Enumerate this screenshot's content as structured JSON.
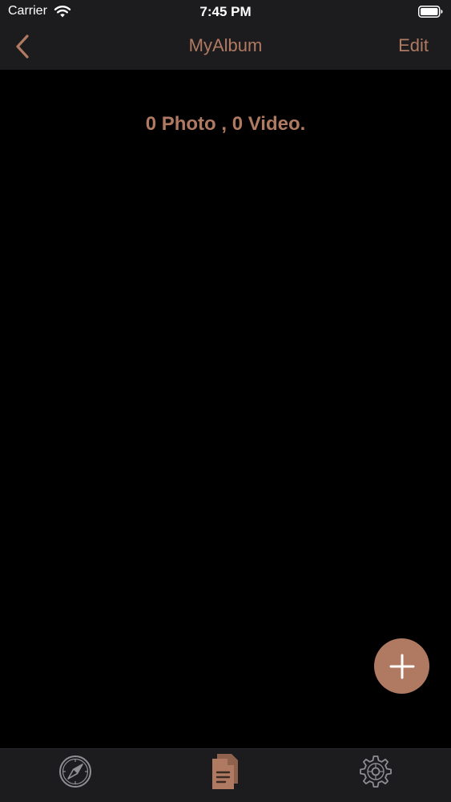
{
  "status_bar": {
    "carrier": "Carrier",
    "time": "7:45 PM",
    "wifi_icon": "wifi-icon",
    "battery_icon": "battery-icon"
  },
  "nav": {
    "title": "MyAlbum",
    "back_icon": "chevron-left-icon",
    "edit_label": "Edit"
  },
  "summary": "0 Photo , 0 Video.",
  "fab": {
    "icon": "plus-icon"
  },
  "tab_bar": {
    "tabs": [
      {
        "icon": "compass-icon",
        "selected": false
      },
      {
        "icon": "document-icon",
        "selected": true
      },
      {
        "icon": "gear-icon",
        "selected": false
      }
    ]
  },
  "colors": {
    "accent": "#b07a62",
    "bar_background": "#1c1c1e",
    "content_background": "#000000",
    "inactive_icon": "#8e8e93"
  }
}
